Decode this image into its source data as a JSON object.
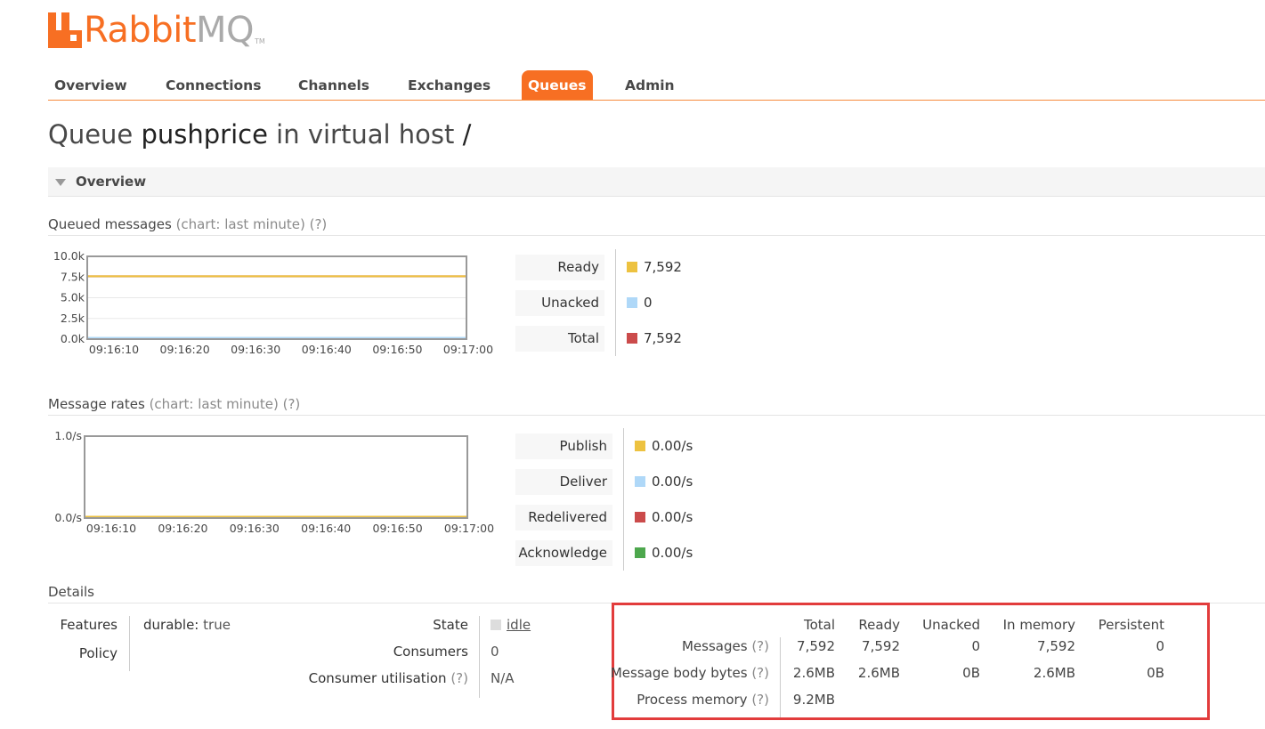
{
  "brand": {
    "name_left": "Rabbit",
    "name_right": "MQ",
    "tm": "TM",
    "color": "#f76f23"
  },
  "tabs": [
    {
      "label": "Overview",
      "active": false
    },
    {
      "label": "Connections",
      "active": false
    },
    {
      "label": "Channels",
      "active": false
    },
    {
      "label": "Exchanges",
      "active": false
    },
    {
      "label": "Queues",
      "active": true
    },
    {
      "label": "Admin",
      "active": false
    }
  ],
  "title": {
    "prefix": "Queue",
    "queue": "pushprice",
    "middle": "in virtual host",
    "vhost": "/"
  },
  "section": {
    "label": "Overview"
  },
  "queued": {
    "heading": "Queued messages",
    "chart_note": "(chart: last minute)",
    "help": "(?)",
    "legend": [
      {
        "label": "Ready",
        "value": "7,592",
        "color": "#edc240"
      },
      {
        "label": "Unacked",
        "value": "0",
        "color": "#afd8f8"
      },
      {
        "label": "Total",
        "value": "7,592",
        "color": "#cb4b4b"
      }
    ]
  },
  "rates": {
    "heading": "Message rates",
    "chart_note": "(chart: last minute)",
    "help": "(?)",
    "legend": [
      {
        "label": "Publish",
        "value": "0.00/s",
        "color": "#edc240"
      },
      {
        "label": "Deliver",
        "value": "0.00/s",
        "color": "#afd8f8"
      },
      {
        "label": "Redelivered",
        "value": "0.00/s",
        "color": "#cb4b4b"
      },
      {
        "label": "Acknowledge",
        "value": "0.00/s",
        "color": "#4da74d"
      }
    ]
  },
  "chart_data": [
    {
      "type": "line",
      "x": [
        "09:16:10",
        "09:16:20",
        "09:16:30",
        "09:16:40",
        "09:16:50",
        "09:17:00"
      ],
      "ylim": [
        0,
        10000
      ],
      "yticks": [
        "0.0k",
        "2.5k",
        "5.0k",
        "7.5k",
        "10.0k"
      ],
      "series": [
        {
          "name": "Ready",
          "values": [
            7592,
            7592,
            7592,
            7592,
            7592,
            7592
          ],
          "color": "#edc240"
        },
        {
          "name": "Unacked",
          "values": [
            0,
            0,
            0,
            0,
            0,
            0
          ],
          "color": "#afd8f8"
        },
        {
          "name": "Total",
          "values": [
            7592,
            7592,
            7592,
            7592,
            7592,
            7592
          ],
          "color": "#cb4b4b"
        }
      ]
    },
    {
      "type": "line",
      "x": [
        "09:16:10",
        "09:16:20",
        "09:16:30",
        "09:16:40",
        "09:16:50",
        "09:17:00"
      ],
      "ylim": [
        0,
        1
      ],
      "yticks": [
        "0.0/s",
        "1.0/s"
      ],
      "series": [
        {
          "name": "Publish",
          "values": [
            0,
            0,
            0,
            0,
            0,
            0
          ],
          "color": "#edc240"
        },
        {
          "name": "Deliver",
          "values": [
            0,
            0,
            0,
            0,
            0,
            0
          ],
          "color": "#afd8f8"
        },
        {
          "name": "Redelivered",
          "values": [
            0,
            0,
            0,
            0,
            0,
            0
          ],
          "color": "#cb4b4b"
        },
        {
          "name": "Acknowledge",
          "values": [
            0,
            0,
            0,
            0,
            0,
            0
          ],
          "color": "#4da74d"
        }
      ]
    }
  ],
  "details": {
    "heading": "Details",
    "features_label": "Features",
    "features_key": "durable:",
    "features_value": "true",
    "policy_label": "Policy",
    "state_label": "State",
    "state_value": "idle",
    "consumers_label": "Consumers",
    "consumers_value": "0",
    "utilisation_label": "Consumer utilisation",
    "utilisation_help": "(?)",
    "utilisation_value": "N/A"
  },
  "msg_table": {
    "headers": [
      "Total",
      "Ready",
      "Unacked",
      "In memory",
      "Persistent"
    ],
    "rows": [
      {
        "label": "Messages",
        "help": "(?)",
        "values": [
          "7,592",
          "7,592",
          "0",
          "7,592",
          "0"
        ]
      },
      {
        "label": "Message body bytes",
        "help": "(?)",
        "values": [
          "2.6MB",
          "2.6MB",
          "0B",
          "2.6MB",
          "0B"
        ]
      },
      {
        "label": "Process memory",
        "help": "(?)",
        "values": [
          "9.2MB"
        ]
      }
    ]
  }
}
